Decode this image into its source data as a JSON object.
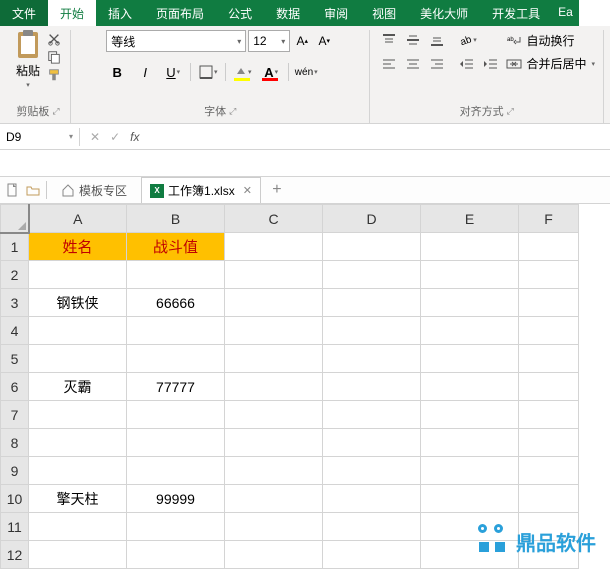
{
  "menu": {
    "file": "文件",
    "home": "开始",
    "insert": "插入",
    "layout": "页面布局",
    "formula": "公式",
    "data": "数据",
    "review": "审阅",
    "view": "视图",
    "beautify": "美化大师",
    "dev": "开发工具",
    "ea": "Ea"
  },
  "ribbon": {
    "clipboard": {
      "paste": "粘贴",
      "label": "剪贴板"
    },
    "font": {
      "name": "等线",
      "size": "12",
      "label": "字体"
    },
    "align": {
      "wrap": "自动换行",
      "merge": "合并后居中",
      "label": "对齐方式"
    }
  },
  "namebox": "D9",
  "tabs": {
    "template": "模板专区",
    "doc": "工作簿1.xlsx"
  },
  "grid": {
    "cols": [
      "A",
      "B",
      "C",
      "D",
      "E",
      "F"
    ],
    "rows": [
      "1",
      "2",
      "3",
      "4",
      "5",
      "6",
      "7",
      "8",
      "9",
      "10",
      "11",
      "12"
    ],
    "header": {
      "name": "姓名",
      "value": "战斗值"
    },
    "data": {
      "r3a": "钢铁侠",
      "r3b": "66666",
      "r6a": "灭霸",
      "r6b": "77777",
      "r10a": "擎天柱",
      "r10b": "99999"
    }
  },
  "watermark": "鼎品软件"
}
